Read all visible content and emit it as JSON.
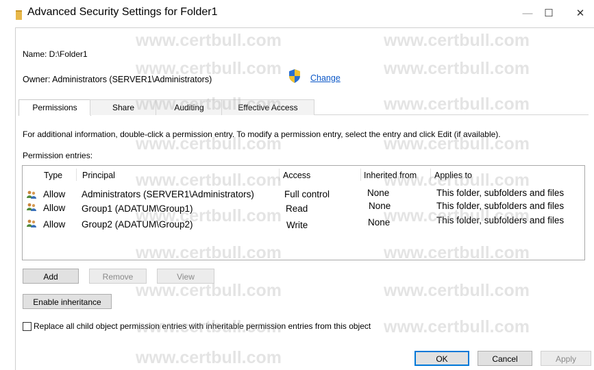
{
  "window": {
    "title": "Advanced Security Settings for Folder1",
    "minimize_label": "—",
    "maximize_label": "☐",
    "close_label": "✕"
  },
  "name_line": "Name:  D:\\Folder1",
  "owner_line": "Owner:  Administrators (SERVER1\\Administrators)",
  "change_link": "Change",
  "tabs": [
    {
      "label": "Permissions"
    },
    {
      "label": "Share"
    },
    {
      "label": "Auditing"
    },
    {
      "label": "Effective Access"
    }
  ],
  "info_text": "For additional information, double-click a permission entry. To modify a permission entry, select the entry and click Edit (if available).",
  "permission_entries_label": "Permission entries:",
  "columns": {
    "type": "Type",
    "principal": "Principal",
    "access": "Access",
    "inherited_from": "Inherited from",
    "applies_to": "Applies to"
  },
  "entries": [
    {
      "type": "Allow",
      "principal": "Administrators (SERVER1\\Administrators)",
      "access": "Full control",
      "inherited_from": "None",
      "applies_to": "This folder, subfolders and files"
    },
    {
      "type": "Allow",
      "principal": "Group1 (ADATUM\\Group1)",
      "access": "Read",
      "inherited_from": "None",
      "applies_to": "This folder, subfolders and files"
    },
    {
      "type": "Allow",
      "principal": "Group2 (ADATUM\\Group2)",
      "access": "Write",
      "inherited_from": "None",
      "applies_to": "This folder, subfolders and files"
    }
  ],
  "buttons": {
    "add": "Add",
    "remove": "Remove",
    "view": "View",
    "enable_inheritance": "Enable inheritance",
    "ok": "OK",
    "cancel": "Cancel",
    "apply": "Apply"
  },
  "replace_checkbox_label": "Replace all child object permission entries with inheritable permission entries from this object",
  "replace_checkbox_checked": false,
  "watermark_text": "www.certbull.com",
  "colors": {
    "link": "#0b57c7",
    "default_button_border": "#0078d7",
    "watermark": "#aaaaaa"
  }
}
